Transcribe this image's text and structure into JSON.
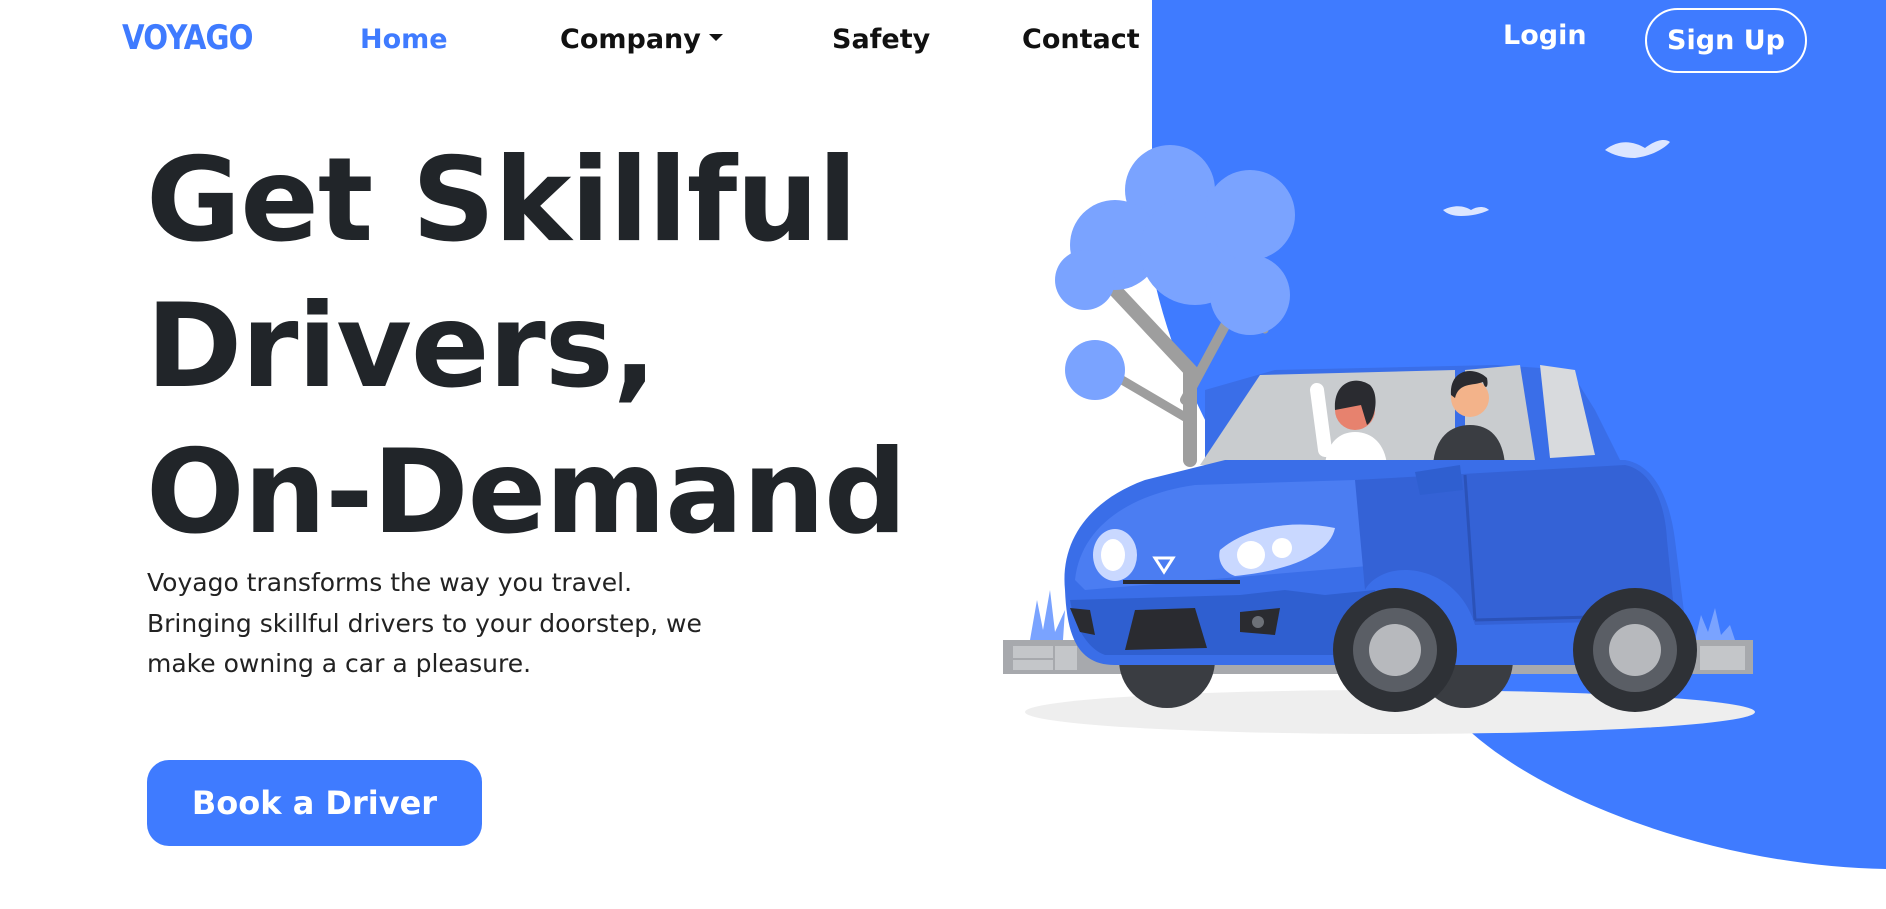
{
  "brand": {
    "name": "VOYAGO"
  },
  "nav": {
    "home": "Home",
    "company": "Company",
    "safety": "Safety",
    "contact": "Contact",
    "login": "Login",
    "signup": "Sign Up"
  },
  "hero": {
    "title_lines": [
      "Get Skillful",
      "Drivers,",
      "On-Demand"
    ],
    "description": "Voyago transforms the way you travel. Bringing skillful drivers to your doorstep, we make owning a car a pleasure.",
    "cta": "Book a Driver"
  },
  "colors": {
    "accent": "#3f7bff",
    "text": "#212529",
    "car_body": "#3a6ee8",
    "tree": "#7aa3ff"
  },
  "icons": {
    "nav_dropdown": "caret-down-icon",
    "illustration": "car-with-driver-illustration"
  }
}
